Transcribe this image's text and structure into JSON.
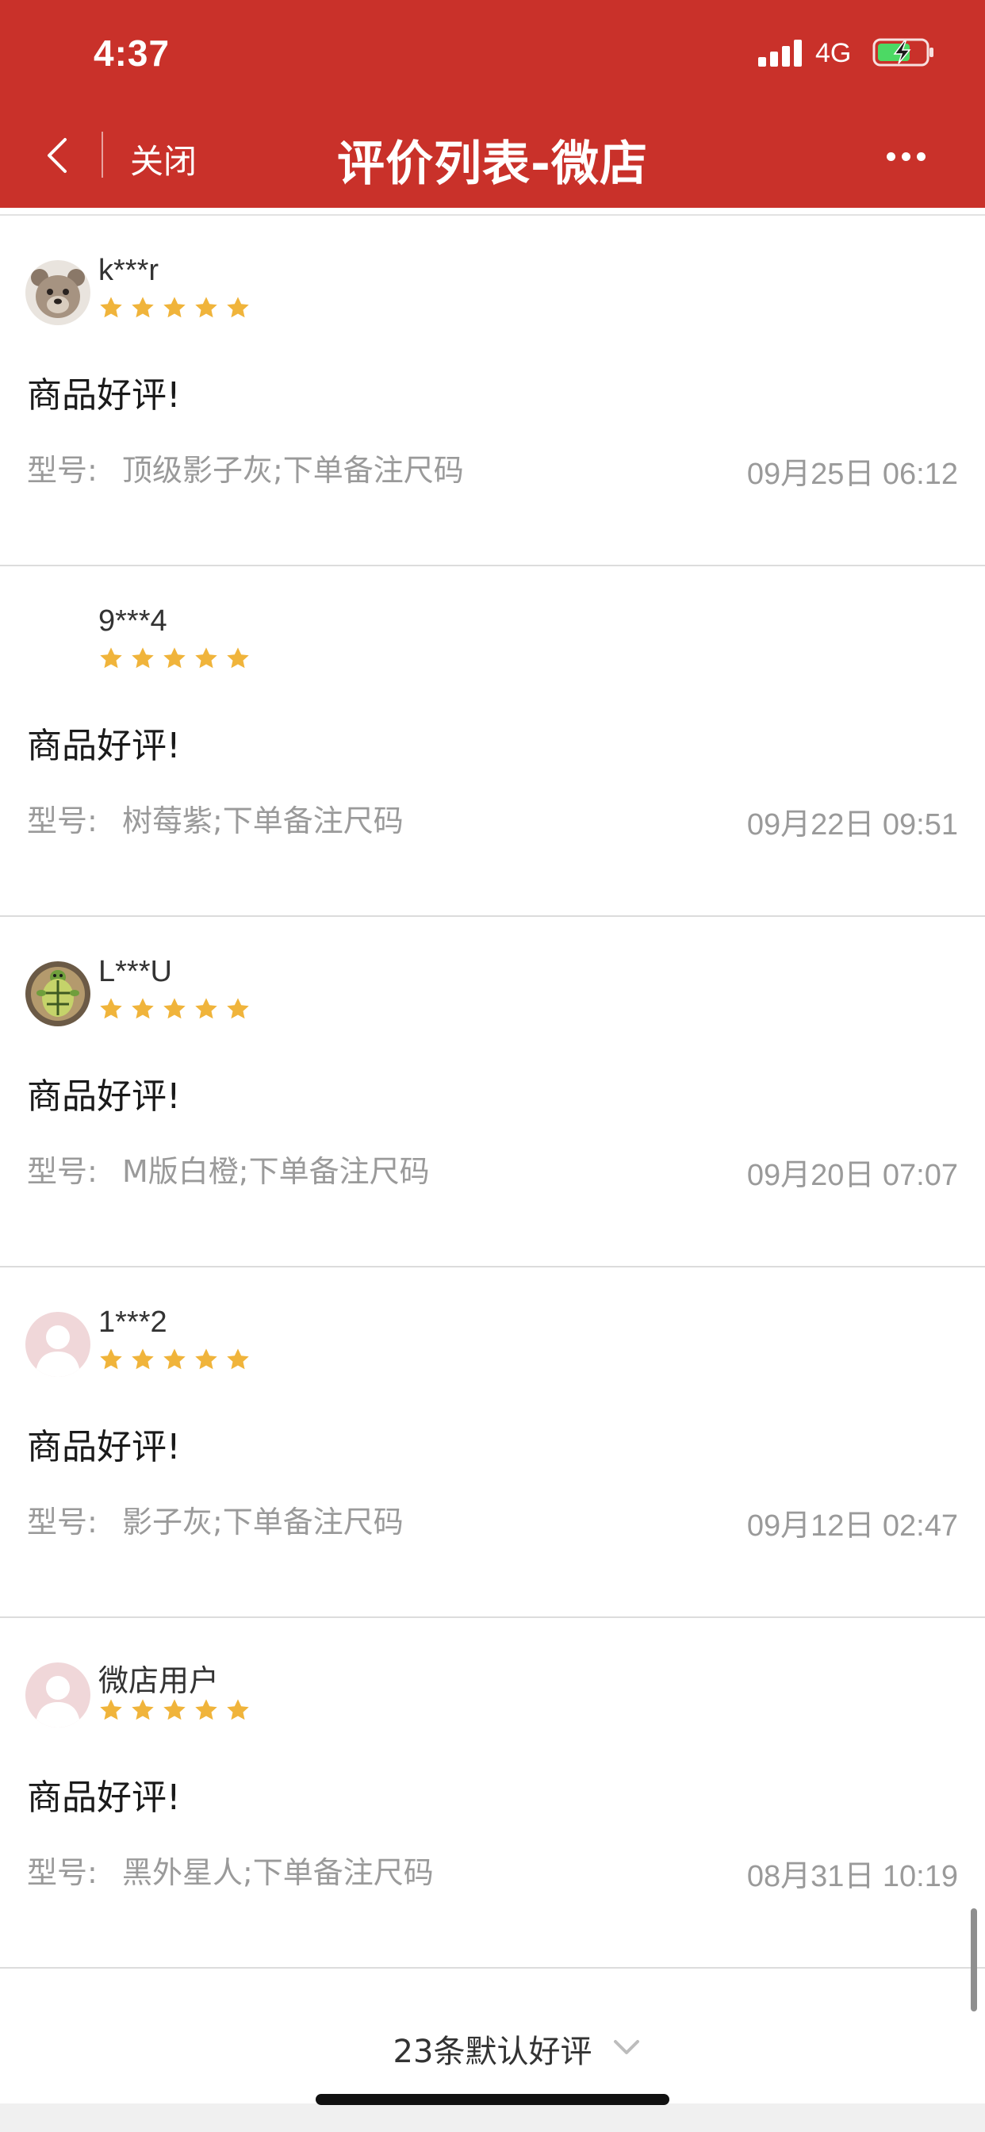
{
  "status_bar": {
    "time": "4:37",
    "network": "4G",
    "signal_icon": "signal-bars-icon",
    "battery_icon": "battery-charging-icon"
  },
  "nav": {
    "back_icon": "chevron-left-icon",
    "close_label": "关闭",
    "title": "评价列表-微店",
    "more_icon": "more-dots-icon"
  },
  "colors": {
    "header_bg": "#c9312a",
    "star": "#f0b43b",
    "muted_text": "#9a9a9a"
  },
  "reviews": [
    {
      "username": "k***r",
      "avatar": "bear-avatar",
      "rating": 5,
      "text": "商品好评!",
      "spec_label": "型号:",
      "spec_value": "顶级影子灰;下单备注尺码",
      "date": "09月25日 06:12"
    },
    {
      "username": "9***4",
      "avatar": "none",
      "rating": 5,
      "text": "商品好评!",
      "spec_label": "型号:",
      "spec_value": "树莓紫;下单备注尺码",
      "date": "09月22日 09:51"
    },
    {
      "username": "L***U",
      "avatar": "turtle-avatar",
      "rating": 5,
      "text": "商品好评!",
      "spec_label": "型号:",
      "spec_value": "M版白橙;下单备注尺码",
      "date": "09月20日 07:07"
    },
    {
      "username": "1***2",
      "avatar": "default-avatar",
      "rating": 5,
      "text": "商品好评!",
      "spec_label": "型号:",
      "spec_value": "影子灰;下单备注尺码",
      "date": "09月12日 02:47"
    },
    {
      "username": "微店用户",
      "avatar": "default-avatar",
      "rating": 5,
      "text": "商品好评!",
      "spec_label": "型号:",
      "spec_value": "黑外星人;下单备注尺码",
      "date": "08月31日 10:19"
    }
  ],
  "footer": {
    "label": "23条默认好评",
    "chevron_icon": "chevron-down-icon"
  }
}
